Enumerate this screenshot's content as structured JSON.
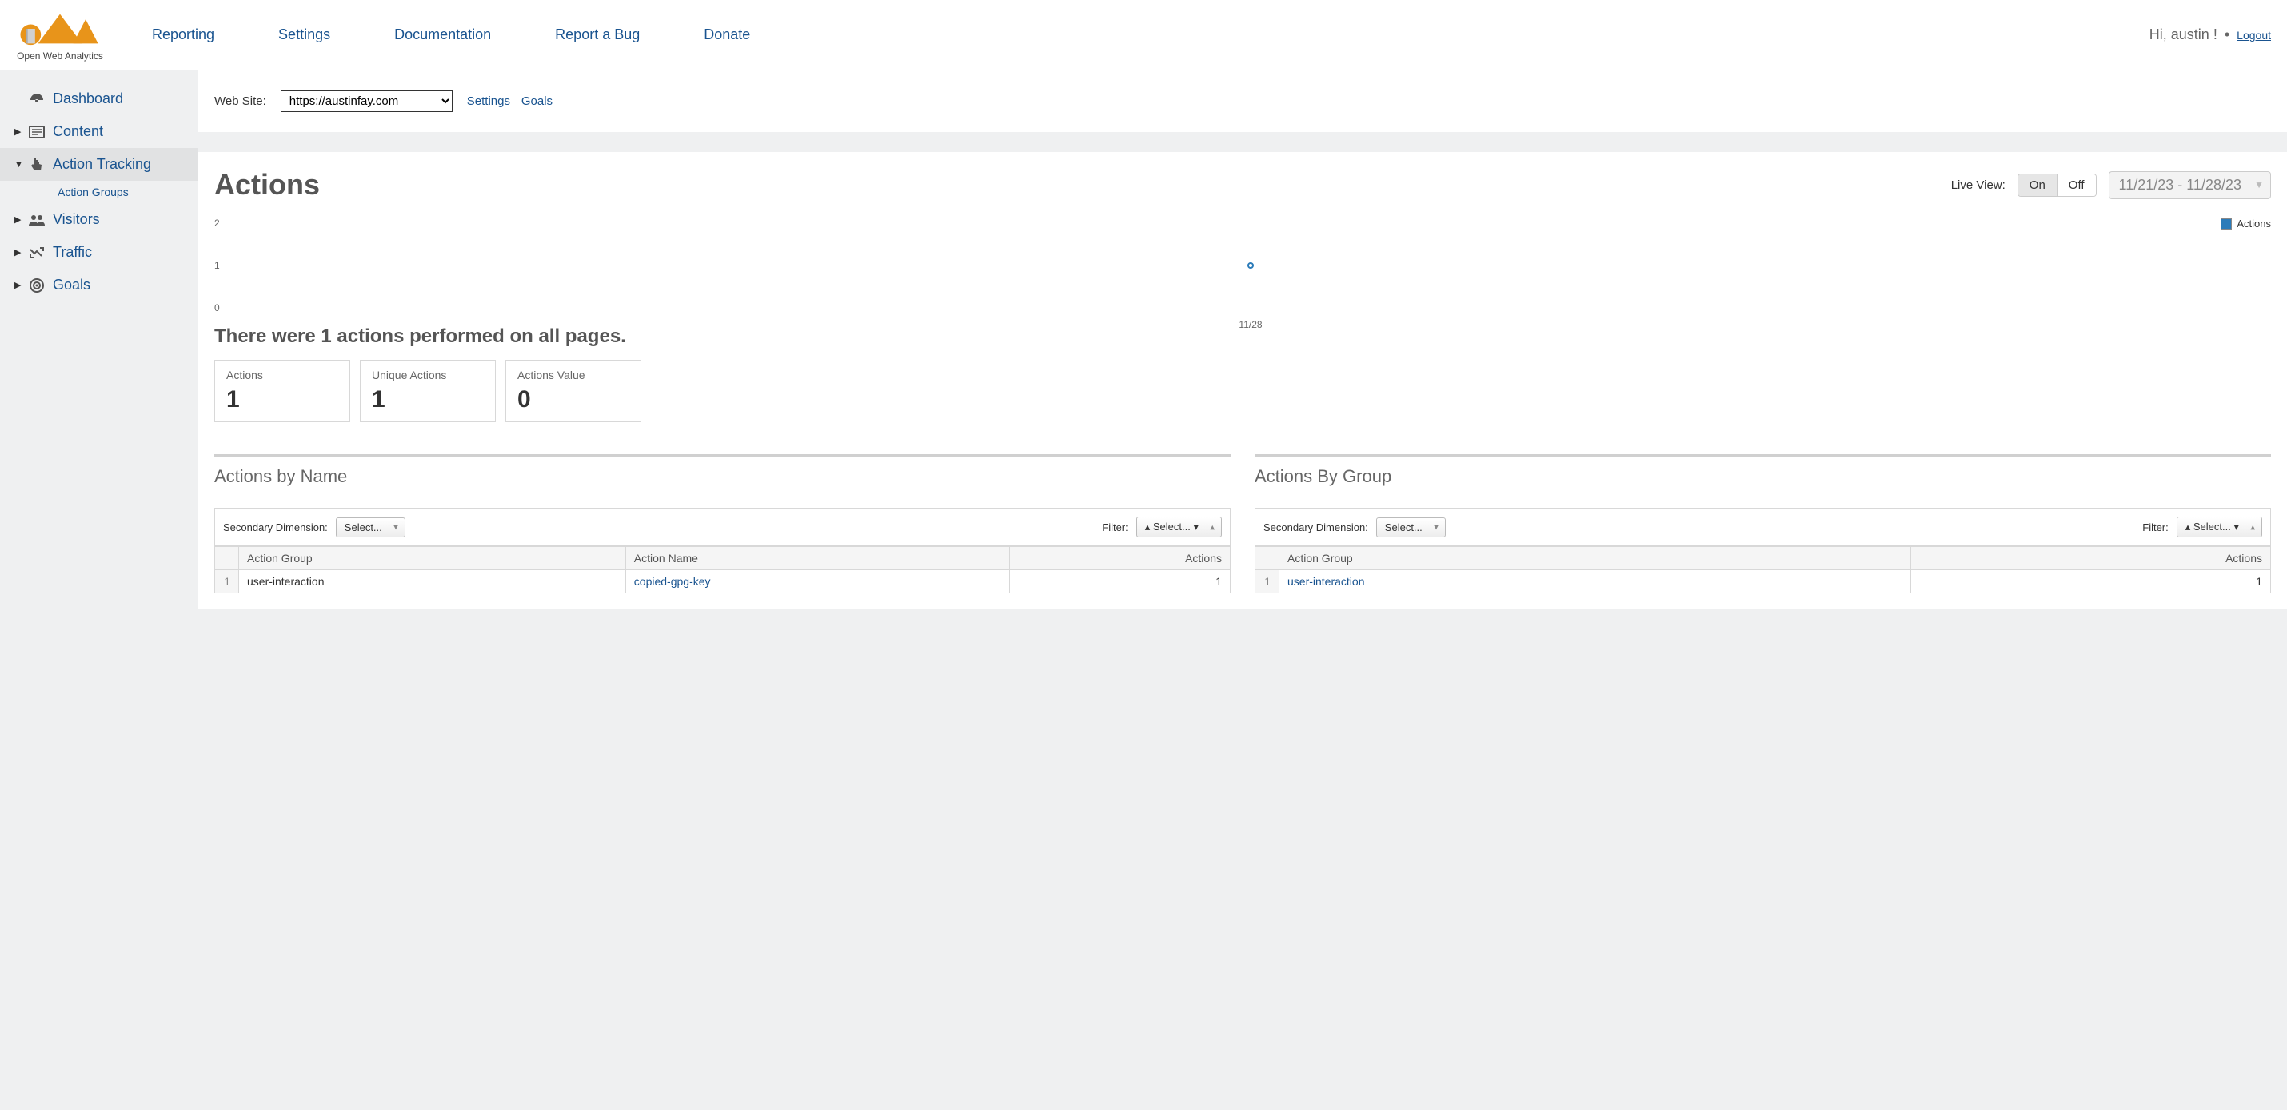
{
  "brand": {
    "name": "Open Web Analytics"
  },
  "nav": {
    "reporting": "Reporting",
    "settings": "Settings",
    "documentation": "Documentation",
    "report_bug": "Report a Bug",
    "donate": "Donate"
  },
  "user": {
    "greeting": "Hi, austin !",
    "logout": "Logout",
    "sep": "•"
  },
  "sidebar": {
    "dashboard": "Dashboard",
    "content": "Content",
    "action_tracking": "Action Tracking",
    "action_groups": "Action Groups",
    "visitors": "Visitors",
    "traffic": "Traffic",
    "goals": "Goals"
  },
  "topbar": {
    "website_label": "Web Site:",
    "website_value": "https://austinfay.com",
    "settings": "Settings",
    "goals": "Goals"
  },
  "page": {
    "title": "Actions",
    "live_view_label": "Live View:",
    "live_on": "On",
    "live_off": "Off",
    "date_range": "11/21/23 - 11/28/23"
  },
  "chart_data": {
    "type": "line",
    "x": [
      "11/28"
    ],
    "series": [
      {
        "name": "Actions",
        "values": [
          1
        ]
      }
    ],
    "ylim": [
      0,
      2
    ],
    "yticks": [
      0,
      1,
      2
    ],
    "xlabel": "",
    "ylabel": ""
  },
  "summary": "There were 1 actions performed on all pages.",
  "stats": [
    {
      "label": "Actions",
      "value": "1"
    },
    {
      "label": "Unique Actions",
      "value": "1"
    },
    {
      "label": "Actions Value",
      "value": "0"
    }
  ],
  "tables": {
    "by_name": {
      "title": "Actions by Name",
      "dim_label": "Secondary Dimension:",
      "dim_value": "Select...",
      "filter_label": "Filter:",
      "filter_value": "Select...",
      "headers": [
        "",
        "Action Group",
        "Action Name",
        "Actions"
      ],
      "rows": [
        {
          "idx": "1",
          "group": "user-interaction",
          "name": "copied-gpg-key",
          "actions": "1"
        }
      ]
    },
    "by_group": {
      "title": "Actions By Group",
      "dim_label": "Secondary Dimension:",
      "dim_value": "Select...",
      "filter_label": "Filter:",
      "filter_value": "Select...",
      "headers": [
        "",
        "Action Group",
        "Actions"
      ],
      "rows": [
        {
          "idx": "1",
          "group": "user-interaction",
          "actions": "1"
        }
      ]
    }
  }
}
